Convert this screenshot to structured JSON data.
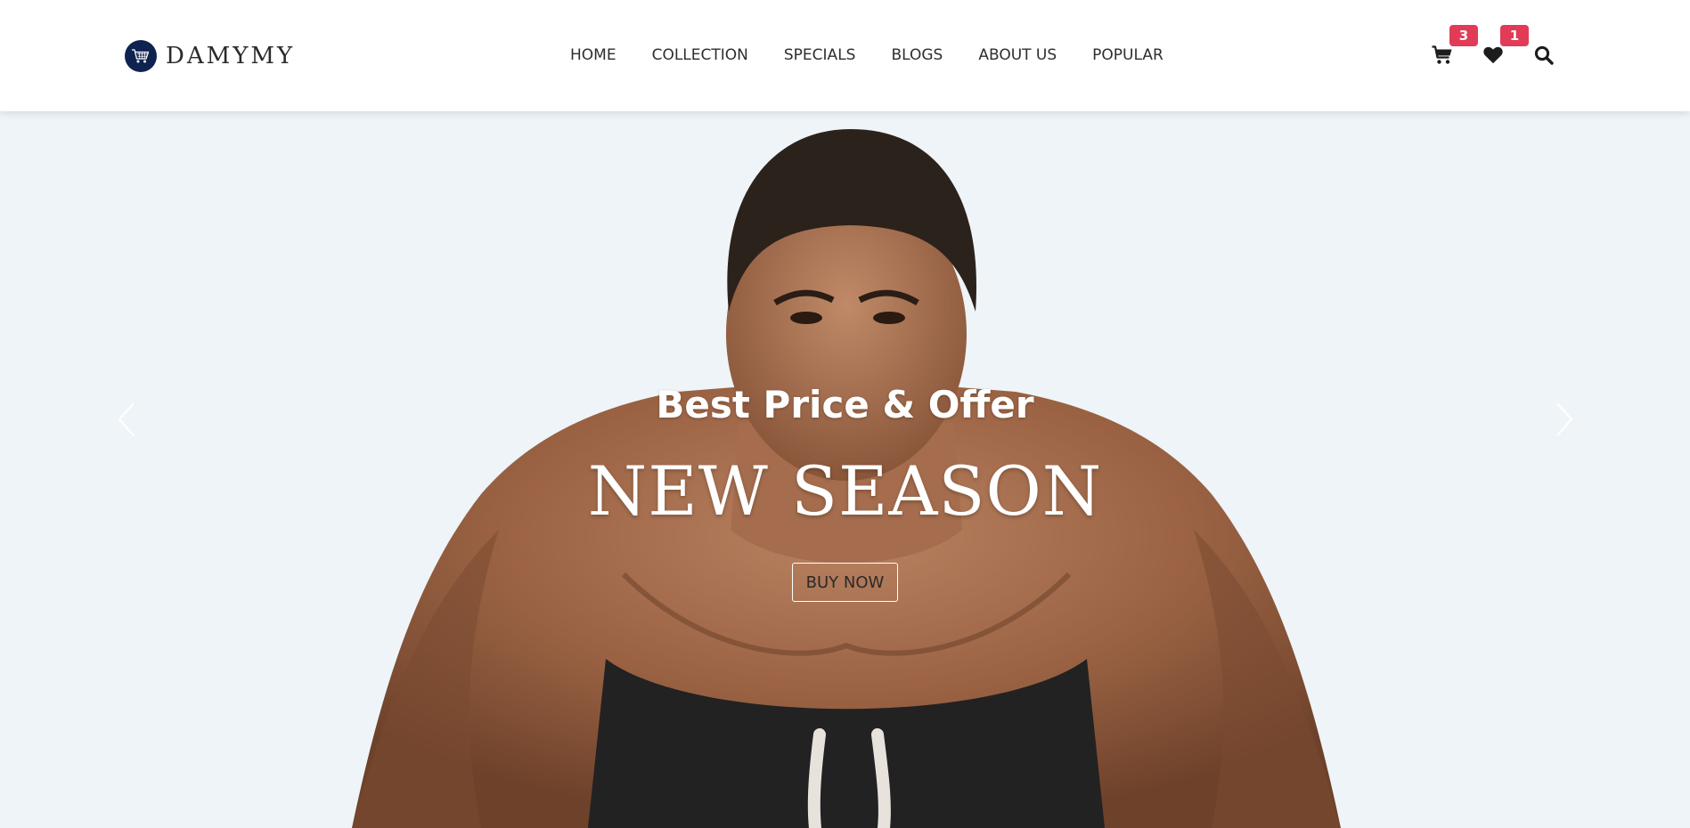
{
  "brand": {
    "name": "DAMYMY",
    "icon": "shopping-cart-icon",
    "badge_color": "#0f2350"
  },
  "nav": {
    "items": [
      {
        "label": "HOME"
      },
      {
        "label": "COLLECTION"
      },
      {
        "label": "SPECIALS"
      },
      {
        "label": "BLOGS"
      },
      {
        "label": "ABOUT US"
      },
      {
        "label": "POPULAR"
      }
    ]
  },
  "actions": {
    "cart": {
      "icon": "cart-icon",
      "count": "3"
    },
    "wishlist": {
      "icon": "heart-icon",
      "count": "1"
    },
    "search": {
      "icon": "search-icon"
    },
    "badge_color": "#e23b57"
  },
  "hero": {
    "subtitle": "Best Price & Offer",
    "title": "NEW SEASON",
    "button_label": "BUY NOW",
    "prev_icon": "chevron-left-icon",
    "next_icon": "chevron-right-icon",
    "background_color": "#eef4f8"
  }
}
